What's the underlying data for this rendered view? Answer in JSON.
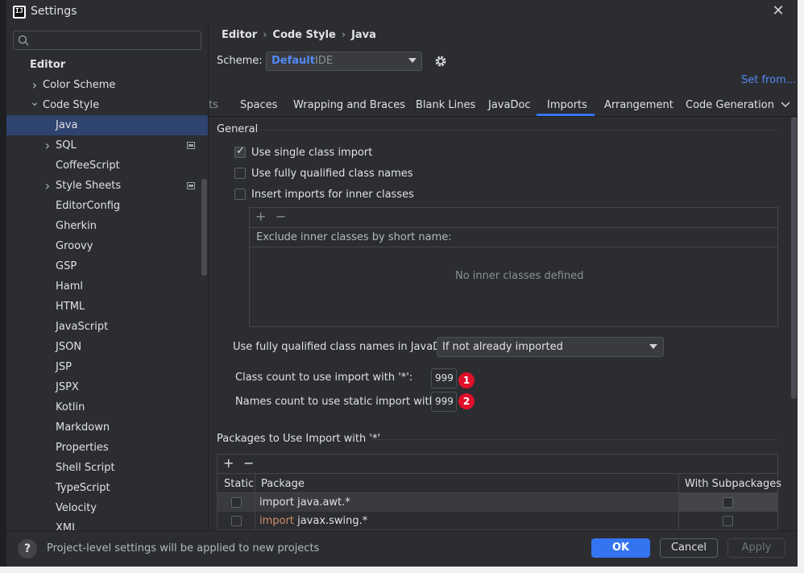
{
  "window": {
    "title": "Settings",
    "app_icon_text": "IJ"
  },
  "search": {
    "placeholder": ""
  },
  "sidebar": {
    "items": [
      {
        "label": "Editor",
        "level": 0,
        "bold": true
      },
      {
        "label": "Color Scheme",
        "level": 1,
        "chevron": "right"
      },
      {
        "label": "Code Style",
        "level": 1,
        "chevron": "down"
      },
      {
        "label": "Java",
        "level": 2,
        "selected": true
      },
      {
        "label": "SQL",
        "level": 2,
        "chevron": "right",
        "project": true
      },
      {
        "label": "CoffeeScript",
        "level": 2
      },
      {
        "label": "Style Sheets",
        "level": 2,
        "chevron": "right",
        "project": true
      },
      {
        "label": "EditorConfig",
        "level": 2
      },
      {
        "label": "Gherkin",
        "level": 2
      },
      {
        "label": "Groovy",
        "level": 2
      },
      {
        "label": "GSP",
        "level": 2
      },
      {
        "label": "Haml",
        "level": 2
      },
      {
        "label": "HTML",
        "level": 2
      },
      {
        "label": "JavaScript",
        "level": 2
      },
      {
        "label": "JSON",
        "level": 2
      },
      {
        "label": "JSP",
        "level": 2
      },
      {
        "label": "JSPX",
        "level": 2
      },
      {
        "label": "Kotlin",
        "level": 2
      },
      {
        "label": "Markdown",
        "level": 2
      },
      {
        "label": "Properties",
        "level": 2
      },
      {
        "label": "Shell Script",
        "level": 2
      },
      {
        "label": "TypeScript",
        "level": 2
      },
      {
        "label": "Velocity",
        "level": 2
      },
      {
        "label": "XML",
        "level": 2
      }
    ]
  },
  "breadcrumb": {
    "a": "Editor",
    "b": "Code Style",
    "c": "Java",
    "sep": "›"
  },
  "scheme": {
    "label": "Scheme:",
    "value": "Default",
    "sub": "IDE",
    "set_from": "Set from..."
  },
  "tabs": {
    "partial": "ts",
    "items": [
      "Spaces",
      "Wrapping and Braces",
      "Blank Lines",
      "JavaDoc",
      "Imports",
      "Arrangement",
      "Code Generation"
    ],
    "active": "Imports"
  },
  "general": {
    "title": "General",
    "use_single_class_import": {
      "label": "Use single class import",
      "checked": true
    },
    "use_fully_qualified": {
      "label": "Use fully qualified class names",
      "checked": false
    },
    "insert_inner": {
      "label": "Insert imports for inner classes",
      "checked": false
    },
    "exclude_header": "Exclude inner classes by short name:",
    "empty": "No inner classes defined",
    "add": "+",
    "remove": "−"
  },
  "javadoc": {
    "label": "Use fully qualified class names in JavaDoc:",
    "value": "If not already imported"
  },
  "counts": {
    "class_label": "Class count to use import with '*':",
    "class_value": "999",
    "static_label": "Names count to use static import with '*':",
    "static_value": "999",
    "badge1": "1",
    "badge2": "2"
  },
  "packages": {
    "title": "Packages to Use Import with '*'",
    "add": "+",
    "remove": "−",
    "headers": {
      "static": "Static",
      "package": "Package",
      "subpackages": "With Subpackages"
    },
    "rows": [
      {
        "keyword": "import",
        "name": "java.awt.*",
        "keyword_colored": false
      },
      {
        "keyword": "import",
        "name": "javax.swing.*",
        "keyword_colored": true
      }
    ]
  },
  "footer": {
    "help": "?",
    "message": "Project-level settings will be applied to new projects",
    "ok": "OK",
    "cancel": "Cancel",
    "apply": "Apply"
  },
  "colors": {
    "accent": "#3574f0",
    "link": "#548af7",
    "selection": "#2e436e",
    "badge": "#e0102a",
    "keyword": "#cf8e6d"
  }
}
